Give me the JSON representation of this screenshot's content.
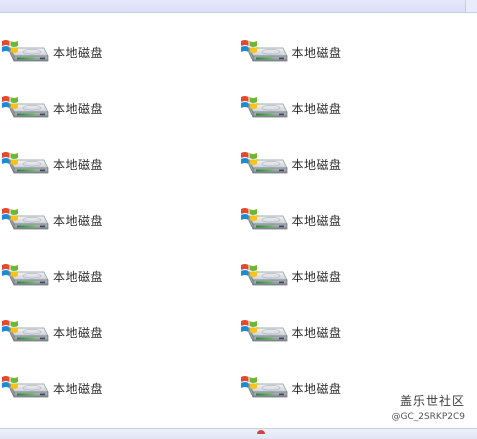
{
  "window": {
    "background": "#ffffff",
    "accent": "#dcdff6"
  },
  "drives": [
    {
      "label": "本地磁盘",
      "icon": "local-disk-windows-icon"
    },
    {
      "label": "本地磁盘",
      "icon": "local-disk-windows-icon"
    },
    {
      "label": "本地磁盘",
      "icon": "local-disk-windows-icon"
    },
    {
      "label": "本地磁盘",
      "icon": "local-disk-windows-icon"
    },
    {
      "label": "本地磁盘",
      "icon": "local-disk-windows-icon"
    },
    {
      "label": "本地磁盘",
      "icon": "local-disk-windows-icon"
    },
    {
      "label": "本地磁盘",
      "icon": "local-disk-windows-icon"
    },
    {
      "label": "本地磁盘",
      "icon": "local-disk-windows-icon"
    },
    {
      "label": "本地磁盘",
      "icon": "local-disk-windows-icon"
    },
    {
      "label": "本地磁盘",
      "icon": "local-disk-windows-icon"
    },
    {
      "label": "本地磁盘",
      "icon": "local-disk-windows-icon"
    },
    {
      "label": "本地磁盘",
      "icon": "local-disk-windows-icon"
    },
    {
      "label": "本地磁盘",
      "icon": "local-disk-windows-icon"
    },
    {
      "label": "本地磁盘",
      "icon": "local-disk-windows-icon"
    }
  ],
  "watermark": {
    "name": "盖乐世社区",
    "handle": "@GC_2SRKP2C9"
  }
}
